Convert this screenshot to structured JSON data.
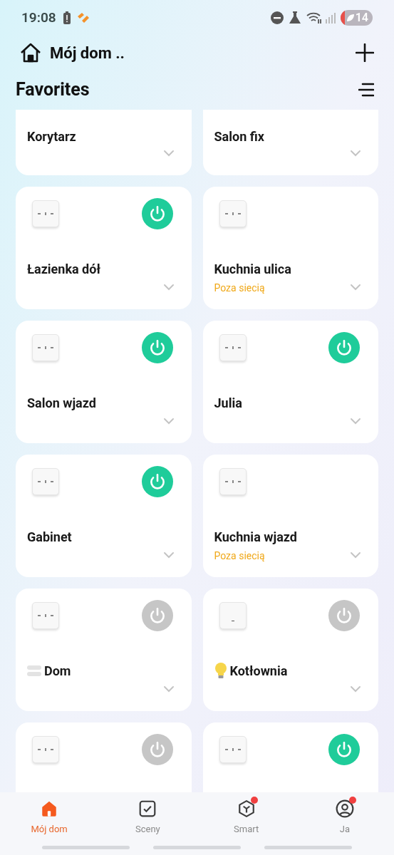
{
  "status_bar": {
    "time": "19:08",
    "battery": "14"
  },
  "header": {
    "home_name": "Mój dom .."
  },
  "section": {
    "title": "Favorites"
  },
  "cards": [
    {
      "kind": "cut",
      "name": "Korytarz"
    },
    {
      "kind": "cut",
      "name": "Salon fix"
    },
    {
      "kind": "switch",
      "name": "Łazienka dół",
      "on": true
    },
    {
      "kind": "offline",
      "name": "Kuchnia ulica",
      "status": "Poza siecią"
    },
    {
      "kind": "switch",
      "name": "Salon wjazd",
      "on": true
    },
    {
      "kind": "switch",
      "name": "Julia",
      "on": true
    },
    {
      "kind": "switch",
      "name": "Gabinet",
      "on": true
    },
    {
      "kind": "offline",
      "name": "Kuchnia wjazd",
      "status": "Poza siecią"
    },
    {
      "kind": "group",
      "name": "Dom",
      "on": false
    },
    {
      "kind": "lamp",
      "name": "Kotłownia",
      "on": false
    },
    {
      "kind": "partial",
      "on": false
    },
    {
      "kind": "partial",
      "on": true
    }
  ],
  "nav": [
    {
      "label": "Mój dom",
      "selected": true,
      "dot": false
    },
    {
      "label": "Sceny",
      "selected": false,
      "dot": false
    },
    {
      "label": "Smart",
      "selected": false,
      "dot": true
    },
    {
      "label": "Ja",
      "selected": false,
      "dot": true
    }
  ]
}
